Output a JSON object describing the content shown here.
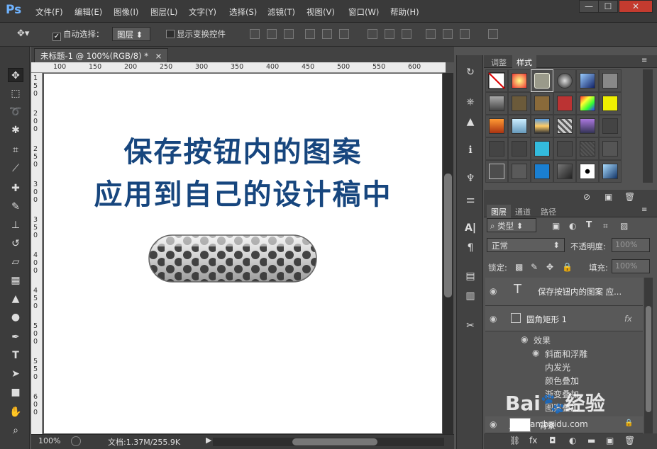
{
  "app": {
    "logo": "Ps"
  },
  "menu": [
    "文件(F)",
    "编辑(E)",
    "图像(I)",
    "图层(L)",
    "文字(Y)",
    "选择(S)",
    "滤镜(T)",
    "视图(V)",
    "窗口(W)",
    "帮助(H)"
  ],
  "window_buttons": [
    "—",
    "☐",
    "✕"
  ],
  "options": {
    "auto_select_label": "自动选择：",
    "auto_select_value": "图层",
    "show_transform_label": "显示变换控件"
  },
  "document": {
    "tab_title": "未标题-1 @ 100%(RGB/8) *",
    "close": "×",
    "ruler_top": [
      "100",
      "150",
      "200",
      "250",
      "300",
      "350",
      "400",
      "450",
      "500",
      "550",
      "600"
    ],
    "ruler_left": [
      "1 5 0",
      "2 0 0",
      "2 5 0",
      "3 0 0",
      "3 5 0",
      "4 0 0",
      "4 5 0",
      "5 0 0",
      "5 5 0",
      "6 0 0"
    ],
    "canvas_text_line1": "保存按钮内的图案",
    "canvas_text_line2": "应用到自己的设计稿中",
    "text_color": "#17467e"
  },
  "status": {
    "zoom": "100%",
    "doc_info": "文档:1.37M/255.9K"
  },
  "panels": {
    "adjust_tabs": [
      "调整",
      "样式"
    ],
    "layers_tabs": [
      "图层",
      "通道",
      "路径"
    ],
    "filter_type": "类型",
    "blend_mode": "正常",
    "opacity_label": "不透明度:",
    "opacity_value": "100%",
    "lock_label": "锁定:",
    "fill_label": "填充:",
    "fill_value": "100%",
    "layers": [
      {
        "name": "保存按钮内的图案 应...",
        "kind": "T"
      },
      {
        "name": "圆角矩形 1",
        "kind": "shape",
        "fx": "fx"
      }
    ],
    "effects_label": "效果",
    "effects": [
      "斜面和浮雕",
      "内发光",
      "颜色叠加",
      "渐变叠加",
      "图案叠加"
    ],
    "background_layer": "背景"
  },
  "watermark": {
    "logo": "Bai",
    "logo2": "经验",
    "url": "jingyan.baidu.com"
  }
}
